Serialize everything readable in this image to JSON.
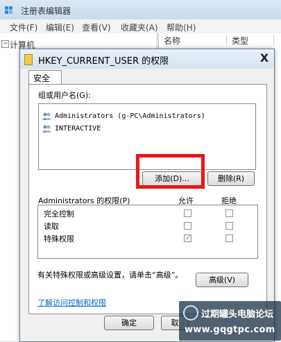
{
  "regedit": {
    "title": "注册表编辑器",
    "menu": [
      "文件(F)",
      "编辑(E)",
      "查看(V)",
      "收藏夹(A)",
      "帮助(H)"
    ],
    "tree_root": "计算机",
    "columns": {
      "name": "名称",
      "type": "类型"
    }
  },
  "dialog": {
    "title": "HKEY_CURRENT_USER 的权限",
    "close_glyph": "X",
    "tab_security": "安全",
    "groups_label": "组或用户名(G):",
    "users": [
      {
        "name": "Administrators (g-PC\\Administrators)",
        "icon": "users-icon"
      },
      {
        "name": "INTERACTIVE",
        "icon": "users-icon"
      }
    ],
    "add_button": "添加(D)...",
    "remove_button": "删除(R)",
    "permissions_label": "Administrators 的权限(P)",
    "allow_header": "允许",
    "deny_header": "拒绝",
    "permissions": [
      {
        "name": "完全控制",
        "allow": false,
        "deny": false
      },
      {
        "name": "读取",
        "allow": false,
        "deny": false
      },
      {
        "name": "特殊权限",
        "allow": true,
        "deny": false
      }
    ],
    "special_text": "有关特殊权限或高级设置，请单击“高级”。",
    "advanced_button": "高级(V)",
    "link_text": "了解访问控制和权限",
    "ok_button": "确定",
    "cancel_partial": "取"
  },
  "watermark": {
    "name": "过期罐头电脑论坛",
    "url": "www.gqgtpc.com"
  },
  "colors": {
    "highlight": "#e81818",
    "link": "#0066cc"
  }
}
